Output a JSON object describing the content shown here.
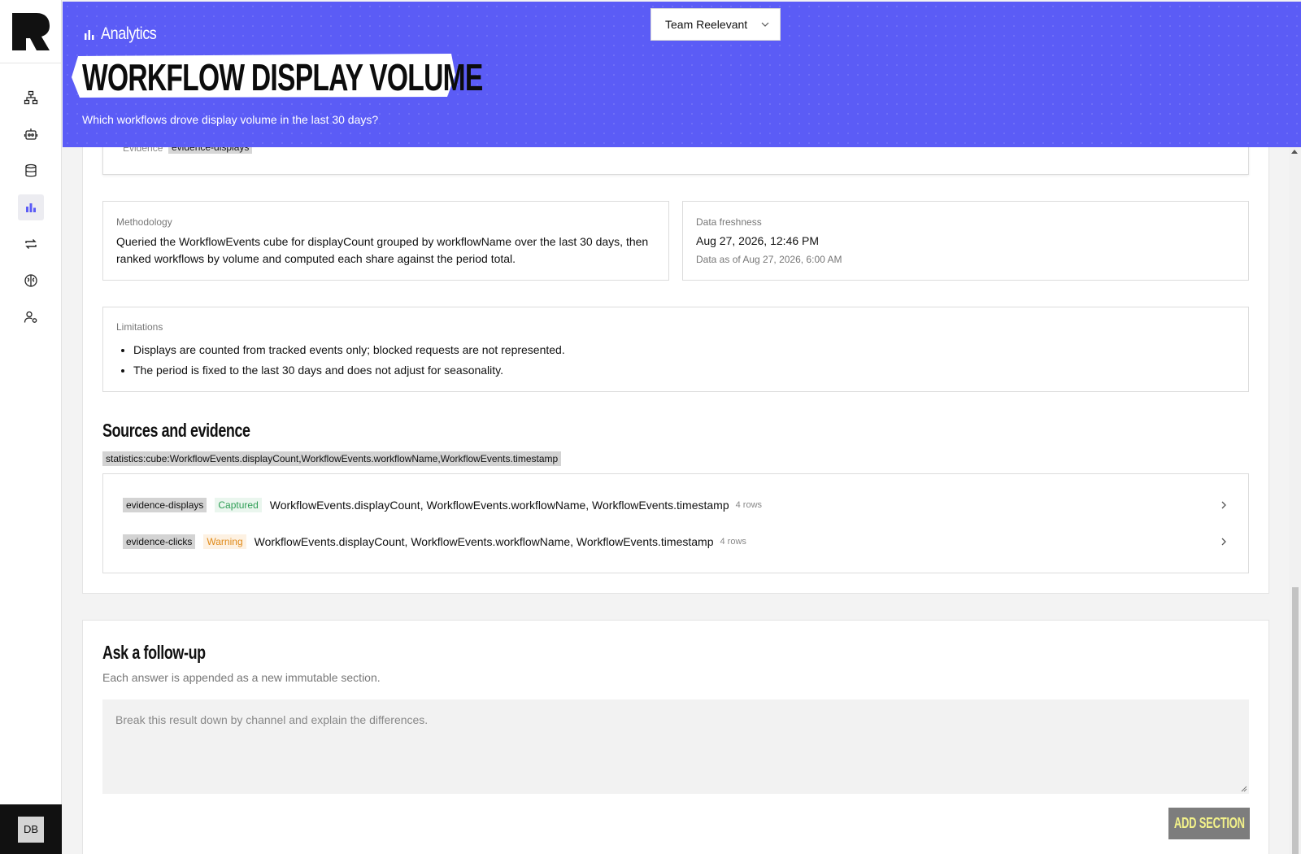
{
  "app": {
    "logo_icon": "reelevant-logo-icon",
    "user_initials": "DB"
  },
  "sidebar": {
    "items": [
      {
        "name": "sitemap-icon",
        "active": false
      },
      {
        "name": "robot-icon",
        "active": false
      },
      {
        "name": "database-icon",
        "active": false
      },
      {
        "name": "bar-chart-icon",
        "active": true
      },
      {
        "name": "sync-icon",
        "active": false
      },
      {
        "name": "brain-icon",
        "active": false
      },
      {
        "name": "user-settings-icon",
        "active": false
      }
    ]
  },
  "header": {
    "breadcrumb": "Analytics",
    "title": "WORKFLOW DISPLAY VOLUME",
    "subtitle": "Which workflows drove display volume in the last 30 days?",
    "team_select": "Team Reelevant",
    "accent": "#5b5cf6"
  },
  "previous_card": {
    "label": "Evidence",
    "tag": "evidence-displays"
  },
  "methodology": {
    "label": "Methodology",
    "text": "Queried the WorkflowEvents cube for displayCount grouped by workflowName over the last 30 days, then ranked workflows by volume and computed each share against the period total."
  },
  "freshness": {
    "label": "Data freshness",
    "date": "Aug 27, 2026, 12:46 PM",
    "as_of": "Data as of Aug 27, 2026, 6:00 AM"
  },
  "limitations": {
    "label": "Limitations",
    "items": [
      "Displays are counted from tracked events only; blocked requests are not represented.",
      "The period is fixed to the last 30 days and does not adjust for seasonality."
    ]
  },
  "sources": {
    "heading": "Sources and evidence",
    "tag": "statistics:cube:WorkflowEvents.displayCount,WorkflowEvents.workflowName,WorkflowEvents.timestamp",
    "evidence": [
      {
        "id": "evidence-displays",
        "status": "Captured",
        "fields": "WorkflowEvents.displayCount, WorkflowEvents.workflowName, WorkflowEvents.timestamp",
        "rows": "4 rows"
      },
      {
        "id": "evidence-clicks",
        "status": "Warning",
        "fields": "WorkflowEvents.displayCount, WorkflowEvents.workflowName, WorkflowEvents.timestamp",
        "rows": "4 rows"
      }
    ]
  },
  "followup": {
    "heading": "Ask a follow-up",
    "subtitle": "Each answer is appended as a new immutable section.",
    "placeholder": "Break this result down by channel and explain the differences.",
    "value": "",
    "button": "ADD SECTION"
  }
}
